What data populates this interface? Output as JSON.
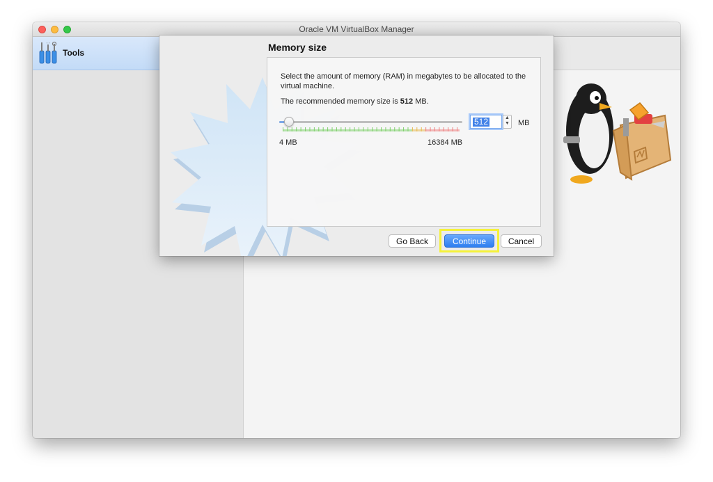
{
  "window": {
    "title": "Oracle VM VirtualBox Manager"
  },
  "sidebar": {
    "tools_label": "Tools"
  },
  "dialog": {
    "title": "Memory size",
    "description": "Select the amount of memory (RAM) in megabytes to be allocated to the virtual machine.",
    "recommended_prefix": "The recommended memory size is ",
    "recommended_value": "512",
    "recommended_suffix": " MB.",
    "slider": {
      "min_label": "4 MB",
      "max_label": "16384 MB",
      "min": 4,
      "max": 16384,
      "value": 512
    },
    "memory_input": {
      "value": "512",
      "unit": "MB"
    },
    "buttons": {
      "back": "Go Back",
      "continue": "Continue",
      "cancel": "Cancel"
    }
  },
  "colors": {
    "accent": "#2e7ef0",
    "highlight": "#f5f23a",
    "tools_selected": "#c3dbf7"
  }
}
